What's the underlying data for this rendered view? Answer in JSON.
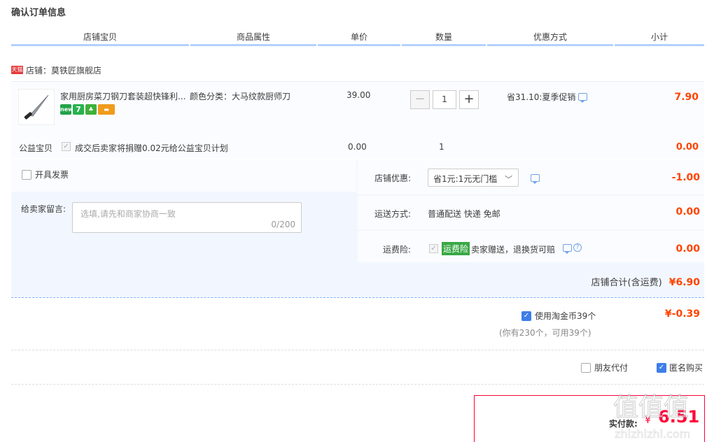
{
  "page": {
    "title": "确认订单信息"
  },
  "columns": [
    "店铺宝贝",
    "商品属性",
    "单价",
    "数量",
    "优惠方式",
    "小计"
  ],
  "shop": {
    "badge": "天猫",
    "name": "店铺：莫铁匠旗舰店"
  },
  "item": {
    "title": "家用厨房菜刀钢刀套装超快锋利...",
    "icons": [
      "new-icon",
      "seven-days-icon",
      "leaf-icon",
      "card-icon"
    ],
    "attr": "颜色分类：大马纹款厨师刀",
    "price": "39.00",
    "qty": "1",
    "minus": "−",
    "plus": "+",
    "promo": "省31.10:夏季促销",
    "subtotal": "7.90"
  },
  "charity": {
    "label": "公益宝贝",
    "text": "成交后卖家将捐赠0.02元给公益宝贝计划",
    "price": "0.00",
    "qty": "1",
    "subtotal": "0.00"
  },
  "options": {
    "invoice_label": "开具发票",
    "message_label": "给卖家留言:",
    "message_placeholder": "选填,请先和商家协商一致",
    "message_count": "0/200",
    "shop_discount_label": "店铺优惠:",
    "shop_discount_value": "省1元:1元无门槛",
    "shop_discount_amount": "-1.00",
    "shipping_label": "运送方式:",
    "shipping_value": "普通配送 快递 免邮",
    "shipping_amount": "0.00",
    "insurance_label": "运费险:",
    "insurance_badge": "运费险",
    "insurance_text": "卖家赠送，退换货可赔",
    "insurance_amount": "0.00",
    "shop_total_label": "店铺合计(含运费)",
    "shop_total_amount": "¥6.90"
  },
  "coins": {
    "label": "使用淘金币39个",
    "amount": "¥-0.39",
    "note": "(你有230个，可用39个)",
    "checked": true
  },
  "extra": {
    "friend_pay_label": "朋友代付",
    "anonymous_label": "匿名购买"
  },
  "payment": {
    "label": "实付款:",
    "currency": "¥",
    "amount": "6.51"
  },
  "watermark": {
    "text": "值值值",
    "url": "zhizhizhi.com"
  },
  "colors": {
    "price_red": "#ff4400",
    "header_line": "#b2d1ff",
    "panel_bg": "#f2f7ff",
    "accent_blue": "#3e7ee8"
  }
}
